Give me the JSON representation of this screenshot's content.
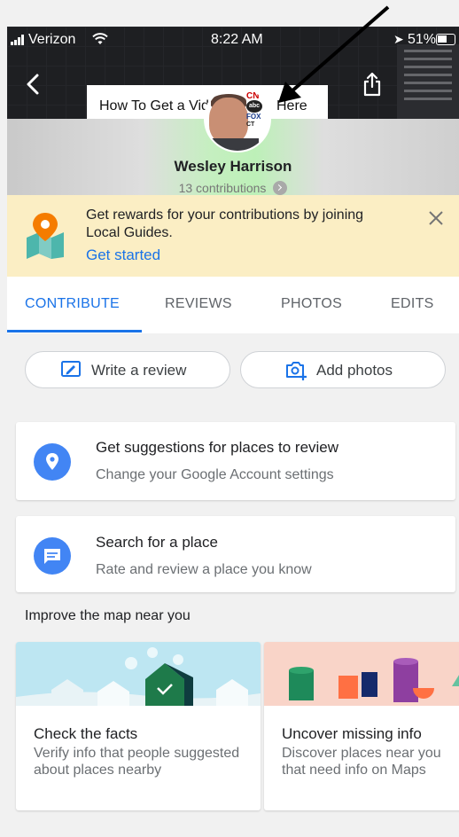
{
  "status_bar": {
    "carrier": "Verizon",
    "time": "8:22 AM",
    "battery": "51%"
  },
  "header": {
    "video_title_left": "How To Get a Vid",
    "video_title_right": "Here",
    "avatar_logos": [
      "CN",
      "abc",
      "FOX",
      "CT"
    ],
    "name": "Wesley Harrison",
    "contributions": "13 contributions"
  },
  "guides_banner": {
    "text": "Get rewards for your contributions by joining Local Guides.",
    "cta": "Get started"
  },
  "tabs": [
    {
      "label": "CONTRIBUTE",
      "active": true
    },
    {
      "label": "REVIEWS",
      "active": false
    },
    {
      "label": "PHOTOS",
      "active": false
    },
    {
      "label": "EDITS",
      "active": false
    }
  ],
  "actions": {
    "write_review": "Write a review",
    "add_photos": "Add photos"
  },
  "cards": [
    {
      "title": "Get suggestions for places to review",
      "subtitle": "Change your Google Account settings",
      "icon": "location-pin-icon"
    },
    {
      "title": "Search for a place",
      "subtitle": "Rate and review a place you know",
      "icon": "chat-icon"
    }
  ],
  "improve": {
    "title": "Improve the map near you",
    "tiles": [
      {
        "title": "Check the facts",
        "desc": "Verify info that people suggested about places nearby"
      },
      {
        "title": "Uncover missing info",
        "desc": "Discover places near you that need info on Maps"
      }
    ]
  },
  "colors": {
    "accent": "#1a73e8",
    "banner": "#fbeec4",
    "icon_blue": "#4285f4"
  }
}
